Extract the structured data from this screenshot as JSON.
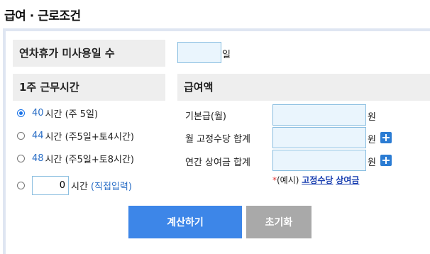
{
  "title": "급여 · 근로조건",
  "unused_leave": {
    "label": "연차휴가 미사용일 수",
    "value": "",
    "unit": "일"
  },
  "weekly_hours": {
    "header": "1주 근무시간",
    "options": [
      {
        "hours": "40",
        "text": "시간 (주 5일)",
        "checked": true
      },
      {
        "hours": "44",
        "text": "시간 (주5일+토4시간)",
        "checked": false
      },
      {
        "hours": "48",
        "text": "시간 (주5일+토8시간)",
        "checked": false
      }
    ],
    "custom": {
      "value": "0",
      "text": "시간",
      "hint": "(직접입력)"
    }
  },
  "wages": {
    "header": "급여액",
    "rows": [
      {
        "label": "기본급(월)",
        "value": "",
        "unit": "원"
      },
      {
        "label": "월 고정수당 합계",
        "value": "",
        "unit": "원"
      },
      {
        "label": "연간 상여금 합계",
        "value": "",
        "unit": "원"
      }
    ],
    "example": {
      "asterisk": "*",
      "prefix": "(예시)",
      "link1": "고정수당",
      "link2": "상여금"
    }
  },
  "buttons": {
    "calculate": "계산하기",
    "reset": "초기화"
  },
  "colors": {
    "calculate_bg": "#3d86e8",
    "reset_bg": "#a9a9a9",
    "accent": "#2a6ec6",
    "input_bg": "#eaf5fd"
  }
}
